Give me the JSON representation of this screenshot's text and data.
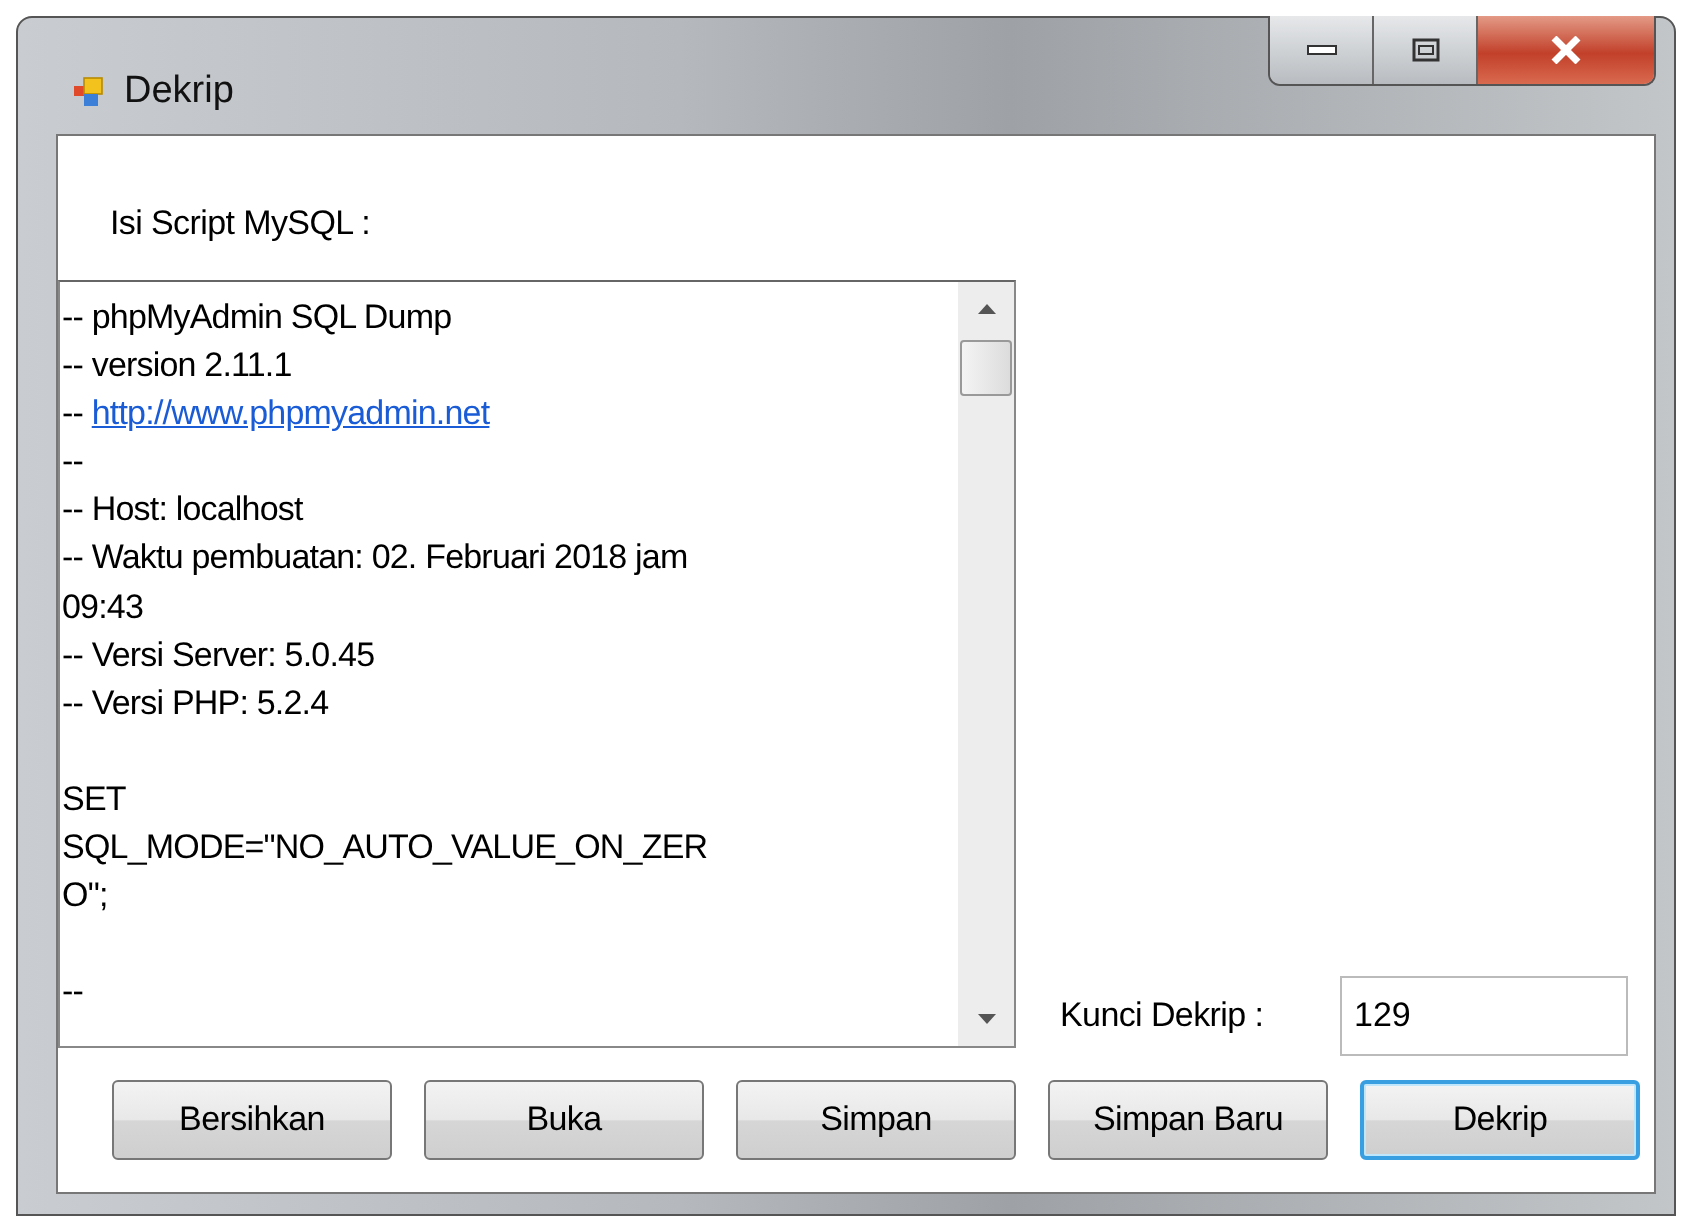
{
  "window": {
    "title": "Dekrip"
  },
  "script_label": "Isi Script MySQL :",
  "script_lines": [
    {
      "kind": "text",
      "text": "-- phpMyAdmin SQL Dump"
    },
    {
      "kind": "text",
      "text": "-- version 2.11.1"
    },
    {
      "kind": "link",
      "text": "-- ",
      "link": "http://www.phpmyadmin.net"
    },
    {
      "kind": "text",
      "text": "--"
    },
    {
      "kind": "text",
      "text": "-- Host: localhost"
    },
    {
      "kind": "text",
      "text": "-- Waktu pembuatan: 02. Februari 2018 jam"
    },
    {
      "kind": "text",
      "text": "09:43"
    },
    {
      "kind": "text",
      "text": "-- Versi Server: 5.0.45"
    },
    {
      "kind": "text",
      "text": "-- Versi PHP: 5.2.4"
    },
    {
      "kind": "blank"
    },
    {
      "kind": "text",
      "text": "SET"
    },
    {
      "kind": "text",
      "text": "SQL_MODE=\"NO_AUTO_VALUE_ON_ZER"
    },
    {
      "kind": "text",
      "text": "O\";"
    },
    {
      "kind": "blank"
    },
    {
      "kind": "text",
      "text": "--"
    }
  ],
  "key": {
    "label": "Kunci Dekrip :",
    "value": "129"
  },
  "buttons": [
    {
      "label": "Bersihkan",
      "default": false
    },
    {
      "label": "Buka",
      "default": false
    },
    {
      "label": "Simpan",
      "default": false
    },
    {
      "label": "Simpan Baru",
      "default": false
    },
    {
      "label": "Dekrip",
      "default": true
    }
  ]
}
